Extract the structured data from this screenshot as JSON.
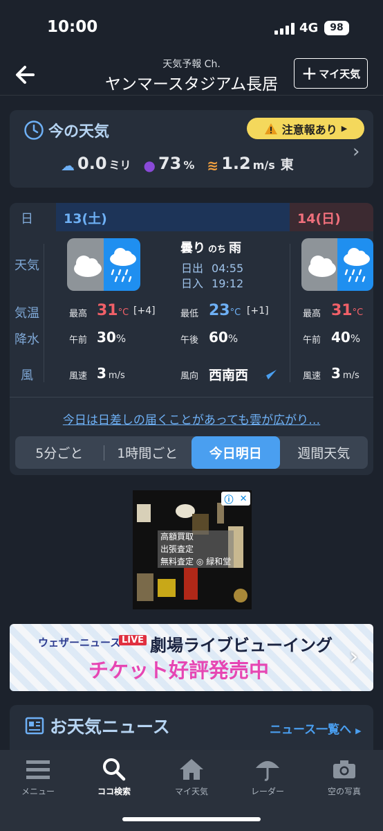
{
  "status_bar": {
    "time": "10:00",
    "network": "4G",
    "battery": "98"
  },
  "header": {
    "channel": "天気予報 Ch.",
    "location": "ヤンマースタジアム長居",
    "my_weather_label": "マイ天気",
    "back_icon": "back-arrow-icon"
  },
  "now": {
    "title": "今の天気",
    "warning": "注意報あり",
    "precip_value": "0.0",
    "precip_unit": "ミリ",
    "humidity_value": "73",
    "humidity_unit": "%",
    "wind_value": "1.2",
    "wind_unit": "m/s",
    "wind_dir": "東"
  },
  "forecast": {
    "row_labels": {
      "day": "日",
      "weather": "天気",
      "temp": "気温",
      "precip": "降水",
      "wind": "風"
    },
    "today": {
      "date": "13(土)",
      "weather_main": "曇り",
      "weather_then": "のち",
      "weather_after": "雨",
      "sunrise_label": "日出",
      "sunrise": "04:55",
      "sunset_label": "日入",
      "sunset": "19:12",
      "high_label": "最高",
      "high": "31",
      "high_unit": "°C",
      "high_diff": "[+4]",
      "low_label": "最低",
      "low": "23",
      "low_unit": "°C",
      "low_diff": "[+1]",
      "am_label": "午前",
      "am_precip": "30",
      "pm_label": "午後",
      "pm_precip": "60",
      "pct": "%",
      "wind_speed_label": "風速",
      "wind_speed": "3",
      "wind_speed_unit": "m/s",
      "wind_dir_label": "風向",
      "wind_dir": "西南西"
    },
    "tomorrow": {
      "date": "14(日)",
      "high_label": "最高",
      "high": "31",
      "high_unit": "°C",
      "am_label": "午前",
      "am_precip": "40",
      "pct": "%",
      "wind_speed_label": "風速",
      "wind_speed": "3",
      "wind_speed_unit": "m/s"
    },
    "summary": "今日は日差しの届くことがあっても雲が広がり…",
    "tabs": [
      "5分ごと",
      "1時間ごと",
      "今日明日",
      "週間天気"
    ],
    "active_tab": "今日明日"
  },
  "ad": {
    "lines": [
      "高額買取",
      "出張査定",
      "無料査定 ◎ 緑和堂"
    ]
  },
  "banner": {
    "brand": "ウェザーニュース",
    "live": "LIVE",
    "title": "劇場ライブビューイング",
    "subtitle": "チケット好評発売中"
  },
  "news": {
    "title": "お天気ニュース",
    "link": "ニュース一覧へ"
  },
  "bottom_nav": [
    {
      "label": "メニュー",
      "icon": "menu-icon"
    },
    {
      "label": "ココ検索",
      "icon": "search-icon"
    },
    {
      "label": "マイ天気",
      "icon": "home-icon"
    },
    {
      "label": "レーダー",
      "icon": "umbrella-icon"
    },
    {
      "label": "空の写真",
      "icon": "camera-icon"
    }
  ],
  "colors": {
    "accent": "#4a9ff0",
    "warning": "#f4d85c",
    "high_temp": "#f06068",
    "low_temp": "#6eb0f5"
  }
}
